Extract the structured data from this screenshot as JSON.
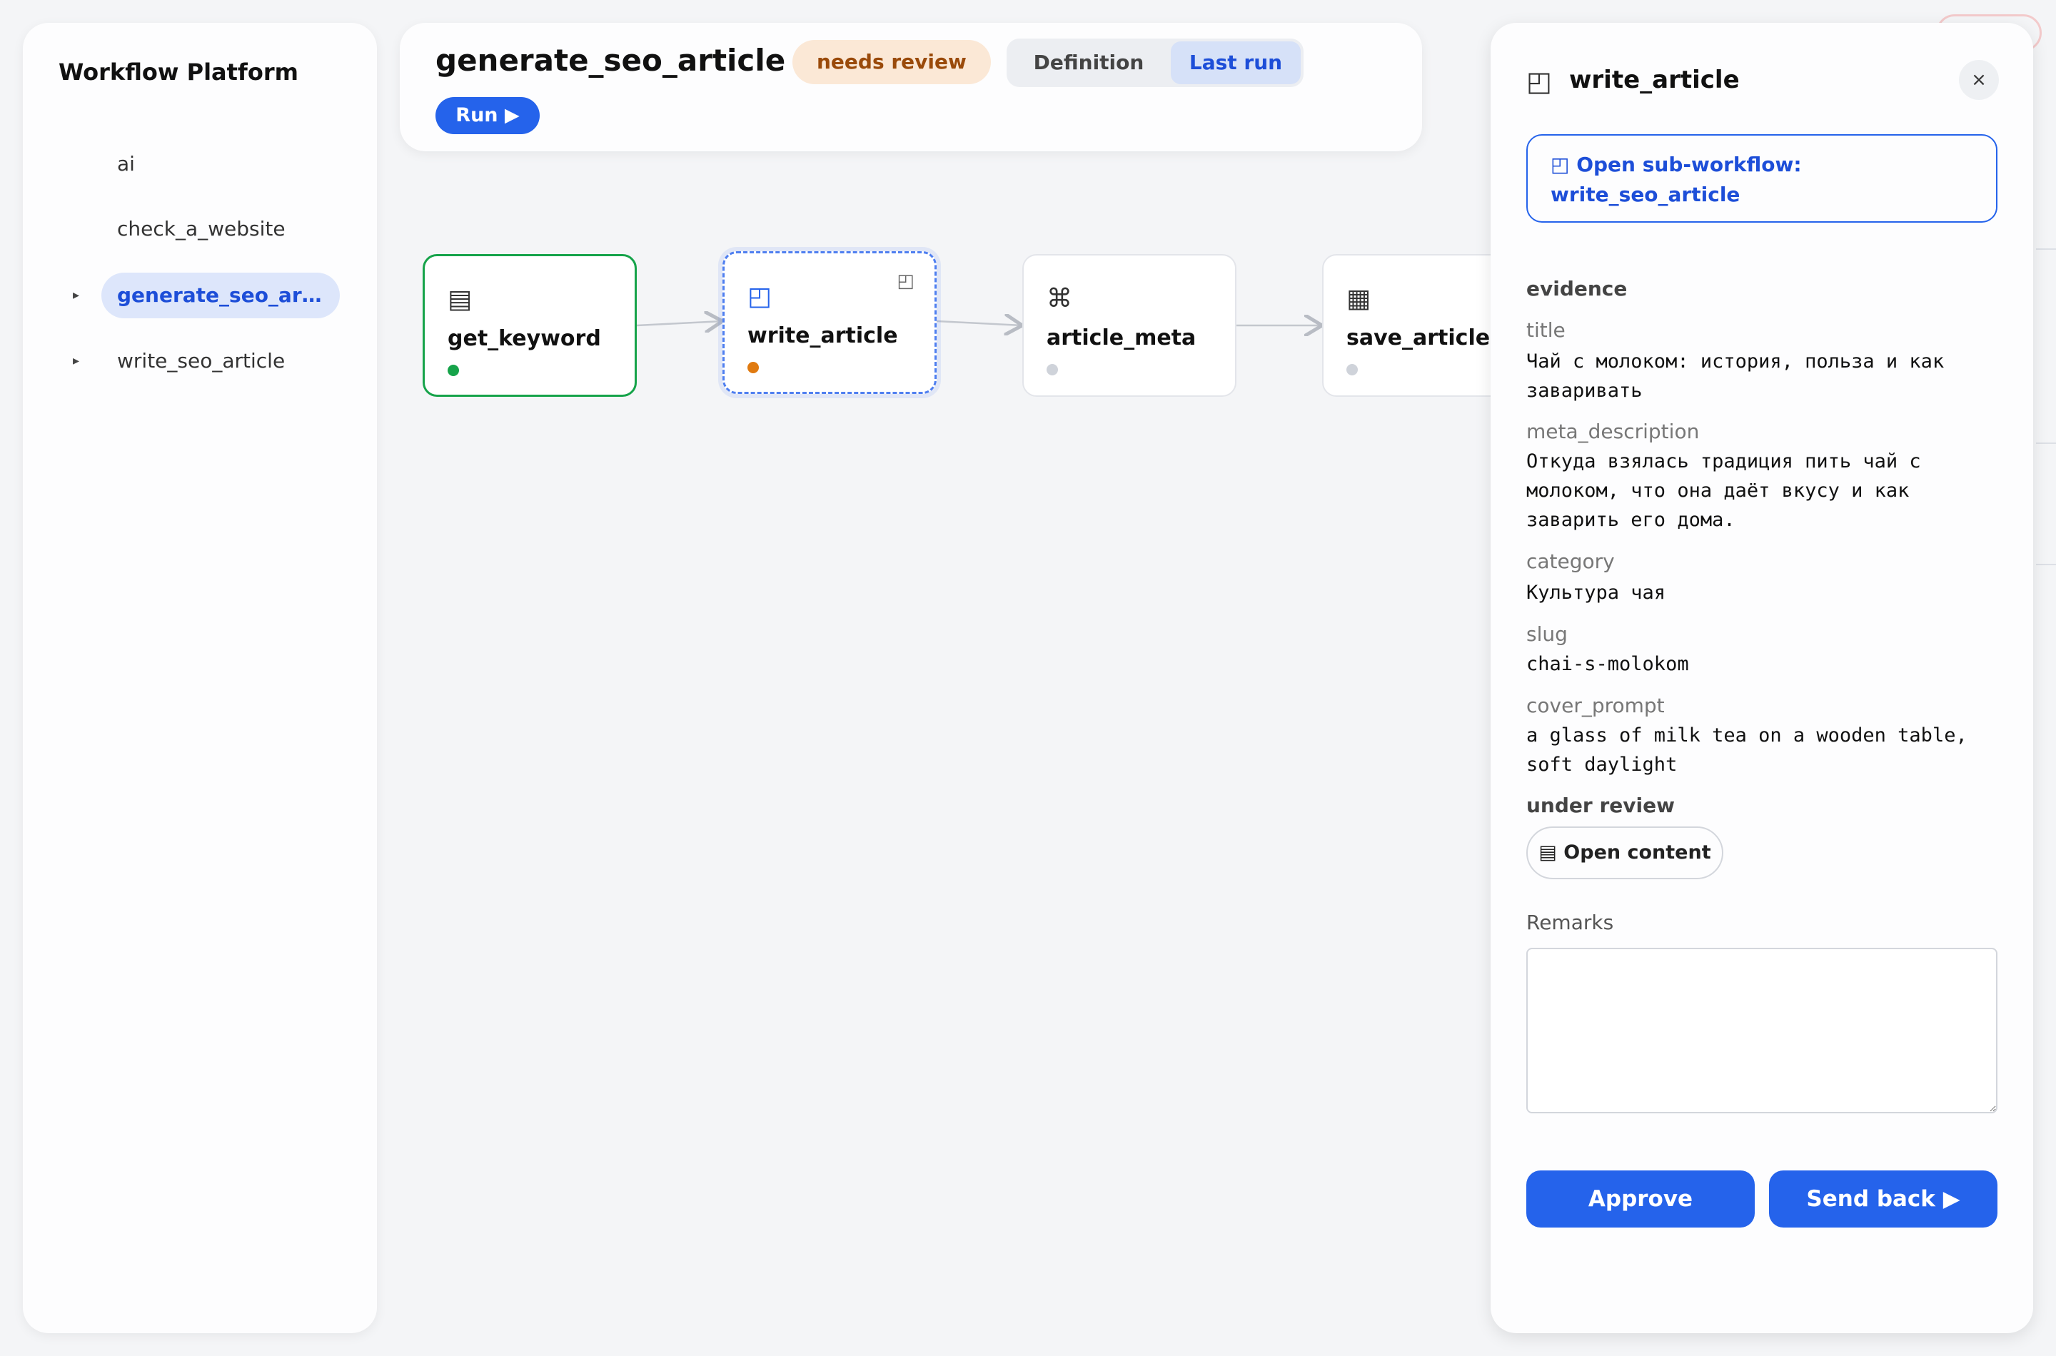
{
  "app": {
    "title": "Workflow Platform"
  },
  "sidebar": {
    "items": [
      {
        "label": "ai",
        "caret": ""
      },
      {
        "label": "check_a_website",
        "caret": ""
      },
      {
        "label": "generate_seo_article",
        "caret": "▸",
        "active": true
      },
      {
        "label": "write_seo_article",
        "caret": "▸"
      }
    ]
  },
  "header": {
    "title": "generate_seo_article",
    "status_badge": "needs review",
    "tabs": [
      {
        "label": "Definition"
      },
      {
        "label": "Last run",
        "active": true
      }
    ],
    "run_label": "Run ▶"
  },
  "graph": {
    "nodes": [
      {
        "label": "get_keyword",
        "icon": "▤",
        "icon_name": "list-icon",
        "status": "done"
      },
      {
        "label": "write_article",
        "icon": "◰",
        "icon_name": "sub-workflow-icon",
        "status": "needs-review",
        "sub_icon": "◰"
      },
      {
        "label": "article_meta",
        "icon": "⌘",
        "icon_name": "command-icon",
        "status": "pending"
      },
      {
        "label": "save_article",
        "icon": "▦",
        "icon_name": "table-icon",
        "status": "pending"
      }
    ]
  },
  "panel": {
    "icon": "◰",
    "title": "write_article",
    "close_label": "×",
    "subworkflow_label": "◰ Open sub-workflow: write_seo_article",
    "evidence_title": "evidence",
    "fields": [
      {
        "key": "title",
        "value": "Чай с молоком: история, польза и как заваривать"
      },
      {
        "key": "meta_description",
        "value": "Откуда взялась традиция пить чай с молоком, что она даёт вкусу и как заварить его дома."
      },
      {
        "key": "category",
        "value": "Культура чая"
      },
      {
        "key": "slug",
        "value": "chai-s-molokom"
      },
      {
        "key": "cover_prompt",
        "value": "a glass of milk tea on a wooden table, soft daylight"
      }
    ],
    "under_review_title": "under review",
    "open_content_label": "▤ Open content",
    "remarks_label": "Remarks",
    "remarks_value": "",
    "approve_label": "Approve",
    "send_back_label": "Send back ▶"
  },
  "colors": {
    "accent": "#2563eb",
    "success": "#16a34a",
    "warning": "#e07a10",
    "badge_bg": "#fbe8d6",
    "badge_text": "#9a4a0a"
  }
}
